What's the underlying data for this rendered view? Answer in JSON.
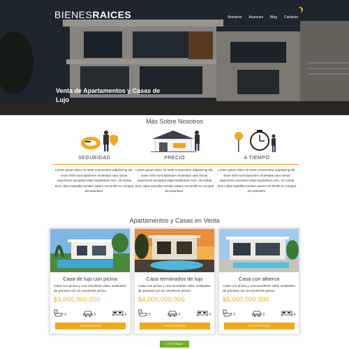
{
  "header": {
    "logo_thin": "BIENES",
    "logo_bold": "RAICES",
    "nav": [
      "Nosotros",
      "Anuncios",
      "Blog",
      "Contacto"
    ],
    "hero_title": "Venta de Apartamentos y Casas de Lujo"
  },
  "about": {
    "title": "Más Sobre Nosotros",
    "features": [
      {
        "title": "SEGURIDAD",
        "text": "Lorem ipsum dolor sit amet consectetur adipisicing elit. Esse nihil exercitationem molestias nam minus asperiores excepturi vitae laudantium rem. Ab soluta eius culpa expedita veniam autem reiciendis et cumque accusantium."
      },
      {
        "title": "PRECIO",
        "text": "Lorem ipsum dolor sit amet consectetur adipisicing elit. Esse nihil exercitationem molestias nam minus asperiores excepturi vitae laudantium rem. Ab soluta eius culpa expedita veniam autem reiciendis et cumque accusantium."
      },
      {
        "title": "A TIEMPO",
        "text": "Lorem ipsum dolor sit amet consectetur adipisicing elit. Esse nihil exercitationem molestias nam minus asperiores excepturi vitae laudantium rem. Ab soluta eius culpa expedita veniam autem reiciendis et cumque accusantium."
      }
    ]
  },
  "listings": {
    "title": "Apartamentos y Casas en Venta",
    "cards": [
      {
        "title": "Casa de lujo con picina",
        "desc": "Casa con picina y una excelente vista, acabados de primera con un excelente precio.",
        "price": "$3,000,000,000",
        "wc": "3",
        "parking": "3",
        "rooms": "4",
        "button": "VER PROPIEDAD"
      },
      {
        "title": "Casa terminados de lujo",
        "desc": "Casa con picina y una excelente vista, acabados de primera con un excelente precio.",
        "price": "$4,000,000,000",
        "wc": "3",
        "parking": "3",
        "rooms": "4",
        "button": "VER PROPIEDAD"
      },
      {
        "title": "Casa con alberca",
        "desc": "Casa con picina y una excelente vista, acabados de primera con un excelente precio.",
        "price": "$5,000,000,000",
        "wc": "3",
        "parking": "3",
        "rooms": "4",
        "button": "VER PROPIEDAD"
      }
    ],
    "all_button": "VER TODAS"
  },
  "colors": {
    "accent": "#f0a91c",
    "green": "#71b226",
    "text": "#333333"
  }
}
